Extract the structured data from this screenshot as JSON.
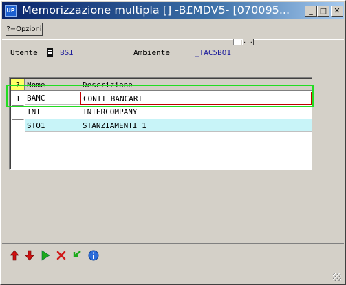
{
  "window": {
    "title": "Memorizzazione multipla [] -B£MDV5- [070095...",
    "icon_text": "UP",
    "controls": {
      "minimize": "_",
      "maximize": "□",
      "close": "✕"
    }
  },
  "toolbar": {
    "options_label": "?=Opzioni",
    "mini_button_label": "..."
  },
  "header": {
    "user_label": "Utente",
    "user_value": "BSI",
    "env_label": "Ambiente",
    "env_value": "_TAC5BO1"
  },
  "table": {
    "columns": [
      "?",
      "Nome",
      "Descrizione"
    ],
    "rows": [
      {
        "index": "1",
        "name": "BANC",
        "description": "CONTI BANCARI"
      },
      {
        "index": "",
        "name": "INT",
        "description": "INTERCOMPANY"
      },
      {
        "index": "",
        "name": "STO1",
        "description": "STANZIAMENTI 1"
      }
    ]
  },
  "bottom_icons": [
    "arrow-up-icon",
    "arrow-down-icon",
    "play-icon",
    "delete-icon",
    "refresh-icon",
    "info-icon"
  ],
  "colors": {
    "title_start": "#0a246a",
    "title_end": "#a6caf0",
    "highlight": "#22dd22",
    "cyan_row": "#c8f4f8",
    "blue_value": "#1e1e9c"
  }
}
